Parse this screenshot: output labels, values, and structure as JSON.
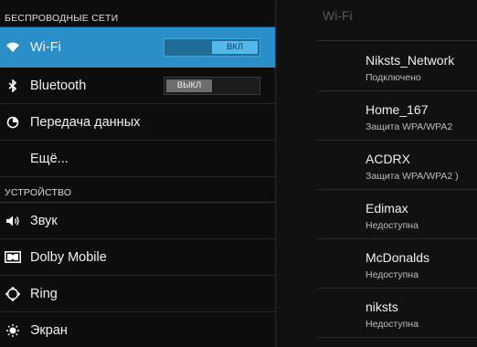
{
  "left": {
    "section_wireless": "БЕСПРОВОДНЫЕ СЕТИ",
    "section_device": "УСТРОЙСТВО",
    "items": [
      {
        "label": "Wi-Fi",
        "icon": "wifi-icon",
        "toggle": "ВКЛ"
      },
      {
        "label": "Bluetooth",
        "icon": "bluetooth-icon",
        "toggle": "ВЫКЛ"
      },
      {
        "label": "Передача данных",
        "icon": "data-usage-icon"
      },
      {
        "label": "Ещё..."
      },
      {
        "label": "Звук",
        "icon": "sound-icon"
      },
      {
        "label": "Dolby Mobile",
        "icon": "dolby-icon"
      },
      {
        "label": "Ring",
        "icon": "ring-icon"
      },
      {
        "label": "Экран",
        "icon": "display-icon"
      }
    ]
  },
  "right": {
    "title": "Wi-Fi",
    "networks": [
      {
        "name": "Niksts_Network",
        "status": "Подключено"
      },
      {
        "name": "Home_167",
        "status": "Защита WPA/WPA2"
      },
      {
        "name": "ACDRX",
        "status": "Защита WPA/WPA2 )"
      },
      {
        "name": "Edimax",
        "status": "Недоступна"
      },
      {
        "name": "McDonalds",
        "status": "Недоступна"
      },
      {
        "name": "niksts",
        "status": "Недоступна"
      }
    ]
  },
  "colors": {
    "accent": "#2a8fc7",
    "background": "#0d0d0d"
  }
}
